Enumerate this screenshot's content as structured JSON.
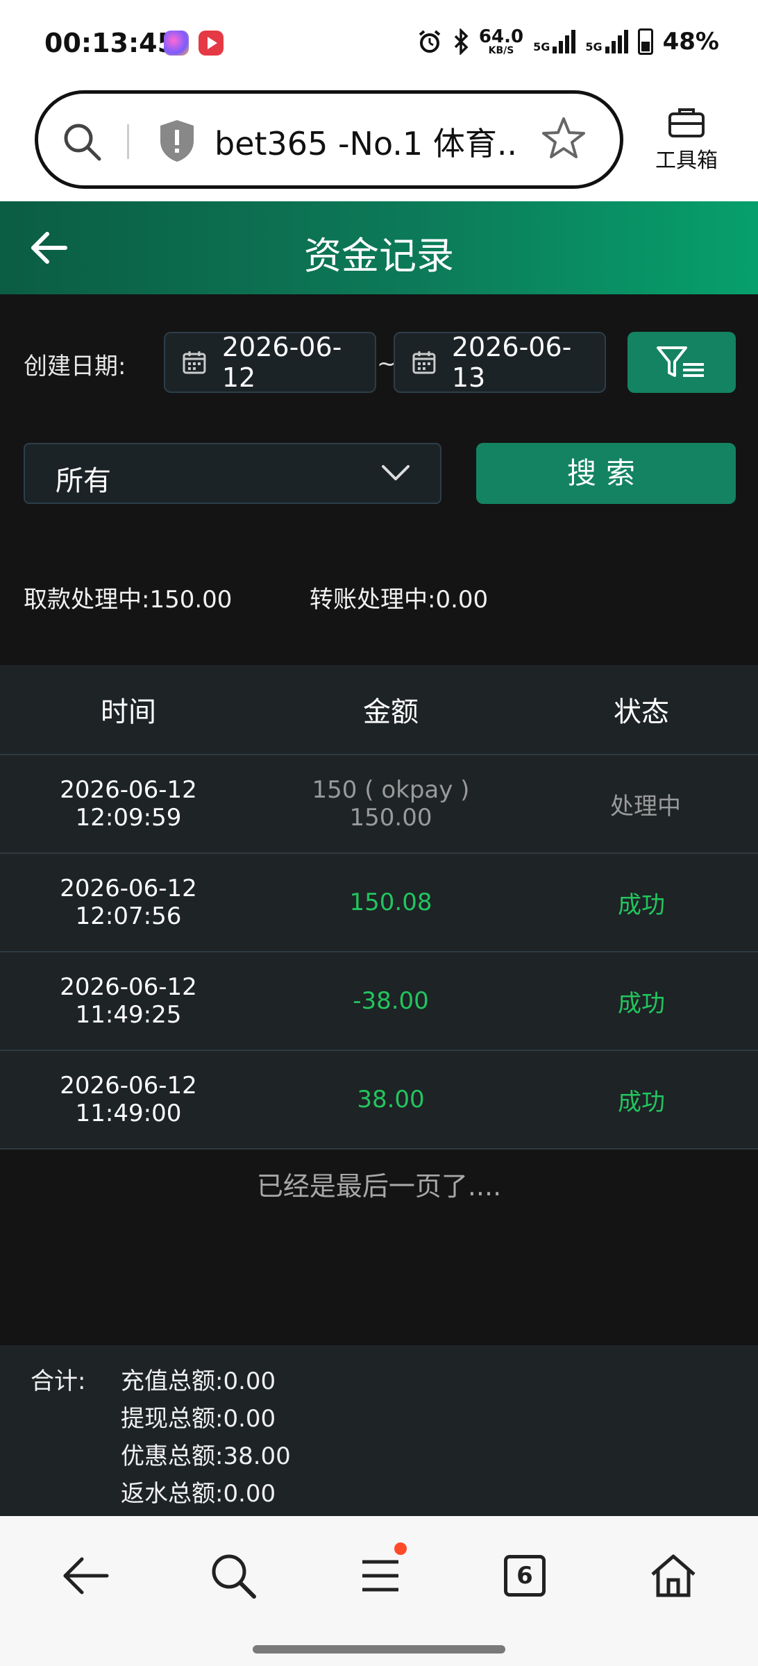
{
  "status_bar": {
    "time": "00:13:45",
    "net_speed": "64.0",
    "net_unit": "KB/S",
    "net_label_1": "5G",
    "net_label_2": "5G",
    "battery": "48%"
  },
  "browser": {
    "url_text": "bet365 -No.1 体育...",
    "toolbox_label": "工具箱"
  },
  "header": {
    "title": "资金记录"
  },
  "filters": {
    "date_label": "创建日期:",
    "date_from": "2026-06-12",
    "date_separator": "~",
    "date_to": "2026-06-13",
    "type_selected": "所有",
    "search_label": "搜索"
  },
  "summary": {
    "withdraw_label": "取款处理中:",
    "withdraw_value": "150.00",
    "transfer_label": "转账处理中:",
    "transfer_value": "0.00"
  },
  "table": {
    "headers": [
      "时间",
      "金额",
      "状态"
    ],
    "rows": [
      {
        "date": "2026-06-12",
        "time": "12:09:59",
        "amount_line1": "150 ( okpay )",
        "amount_line2": "150.00",
        "status": "处理中"
      },
      {
        "date": "2026-06-12",
        "time": "12:07:56",
        "amount_line1": "150.08",
        "amount_line2": "",
        "status": "成功"
      },
      {
        "date": "2026-06-12",
        "time": "11:49:25",
        "amount_line1": "-38.00",
        "amount_line2": "",
        "status": "成功"
      },
      {
        "date": "2026-06-12",
        "time": "11:49:00",
        "amount_line1": "38.00",
        "amount_line2": "",
        "status": "成功"
      }
    ],
    "end_note": "已经是最后一页了...."
  },
  "totals": {
    "label": "合计:",
    "items": [
      {
        "label": "充值总额:",
        "value": "0.00"
      },
      {
        "label": "提现总额:",
        "value": "0.00"
      },
      {
        "label": "优惠总额:",
        "value": "38.00"
      },
      {
        "label": "返水总额:",
        "value": "0.00"
      }
    ]
  },
  "bottom_nav": {
    "tab_count": "6"
  },
  "colors": {
    "accent_green": "#138361",
    "success_green": "#22c55e",
    "pending_grey": "#9a9a9a"
  }
}
